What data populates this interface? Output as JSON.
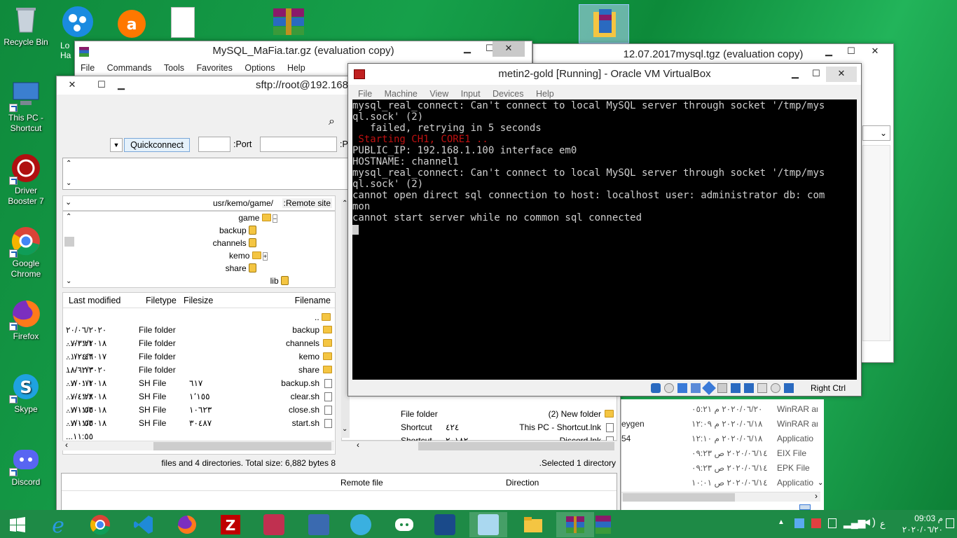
{
  "desktop_icons": [
    {
      "label": "Recycle Bin",
      "color": "#9aa6b2"
    },
    {
      "label": "This PC - Shortcut",
      "color": "#3b7fd0"
    },
    {
      "label": "Driver Booster 7",
      "color": "#d01818"
    },
    {
      "label": "Google Chrome",
      "color": "#e0a020"
    },
    {
      "label": "Firefox",
      "color": "#ff7a1a"
    },
    {
      "label": "Skype",
      "color": "#1fa2e0"
    },
    {
      "label": "Discord",
      "color": "#5865f2"
    }
  ],
  "top_icons_label": "Lo\nHa",
  "rar1": {
    "title": "MySQL_MaFia.tar.gz (evaluation copy)",
    "menu": [
      "File",
      "Commands",
      "Tools",
      "Favorites",
      "Options",
      "Help"
    ]
  },
  "rar2": {
    "title": "12.07.2017mysql.tgz (evaluation copy)"
  },
  "filezilla": {
    "title": "sftp://root@192.168",
    "quickconnect": "Quickconnect",
    "port_label": ":Port",
    "remote_label": ":Remote site",
    "remote_path": "usr/kemo/game/",
    "tree": [
      "game",
      "backup",
      "channels",
      "kemo",
      "share",
      "lib"
    ],
    "headers": [
      "Last modified",
      "Filetype",
      "Filesize",
      "Filename"
    ],
    "parent": "..",
    "rows": [
      {
        "name": "backup",
        "type": "File folder",
        "size": "",
        "date": "٢٠/٠٦/٢٠٢٠ ٠٣:٢١...",
        "kind": "folder"
      },
      {
        "name": "channels",
        "type": "File folder",
        "size": "",
        "date": "٠٧/٠١/٢٠١٨ ١٢:٤٦...",
        "kind": "folder"
      },
      {
        "name": "kemo",
        "type": "File folder",
        "size": "",
        "date": "٠١/٠٤/٢٠١٧ ٠٦:١٣...",
        "kind": "folder"
      },
      {
        "name": "share",
        "type": "File folder",
        "size": "",
        "date": "١٨/٠٢/٢٠٢٠ ١٠:١١...",
        "kind": "folder"
      },
      {
        "name": "backup.sh",
        "type": "SH File",
        "size": "٦١٧",
        "date": "٠٧/٠١/٢٠١٨ ٠٤:٢٨...",
        "kind": "file"
      },
      {
        "name": "clear.sh",
        "type": "SH File",
        "size": "١٬١٥٥",
        "date": "٠٧/٠١/٢٠١٨ ١١:٥٥...",
        "kind": "file"
      },
      {
        "name": "close.sh",
        "type": "SH File",
        "size": "١٠٦٢٣",
        "date": "٠٧/٠١/٢٠١٨ ١١:٥٥...",
        "kind": "file"
      },
      {
        "name": "start.sh",
        "type": "SH File",
        "size": "٣٠٤٨٧",
        "date": "٠٧/٠١/٢٠١٨ ١١:٥٥...",
        "kind": "file"
      }
    ],
    "status_left": "files and 4 directories. Total size: 6,882 bytes 8",
    "status_right": ".Selected 1 directory",
    "local_rows": [
      {
        "name": "(2) New folder",
        "type": "File folder",
        "size": ""
      },
      {
        "name": "This PC - Shortcut.lnk",
        "type": "Shortcut",
        "size": "٤٢٤"
      },
      {
        "name": "Discord.lnk",
        "type": "Shortcut",
        "size": "٢٠١٨٢"
      }
    ],
    "queue_headers": [
      "Remote file",
      "Direction"
    ]
  },
  "vbox": {
    "title": "metin2-gold [Running] - Oracle VM VirtualBox",
    "menu": [
      "File",
      "Machine",
      "View",
      "Input",
      "Devices",
      "Help"
    ],
    "terminal": [
      {
        "text": "mysql_real_connect: Can't connect to local MySQL server through socket '/tmp/mys",
        "red": false
      },
      {
        "text": "ql.sock' (2)",
        "red": false
      },
      {
        "text": "   failed, retrying in 5 seconds",
        "red": false
      },
      {
        "text": " Starting CH1, CORE1 ..",
        "red": true
      },
      {
        "text": "PUBLIC_IP: 192.168.1.100 interface em0",
        "red": false
      },
      {
        "text": "HOSTNAME: channel1",
        "red": false
      },
      {
        "text": "mysql_real_connect: Can't connect to local MySQL server through socket '/tmp/mys",
        "red": false
      },
      {
        "text": "ql.sock' (2)",
        "red": false
      },
      {
        "text": "cannot open direct sql connection to host: localhost user: administrator db: com",
        "red": false
      },
      {
        "text": "mon",
        "red": false
      },
      {
        "text": "cannot start server while no common sql connected",
        "red": false
      }
    ],
    "host_key": "Right Ctrl"
  },
  "explorer_rows": [
    {
      "name": "",
      "date": "٢٠٢٠/٠٦/٢٠ م ٠٥:٢١",
      "type": "WinRAR ar"
    },
    {
      "name": "eygen",
      "date": "٢٠٢٠/٠٦/١٨ م ١٢:٠٩",
      "type": "WinRAR ar"
    },
    {
      "name": "54",
      "date": "٢٠٢٠/٠٦/١٨ م ١٢:١٠",
      "type": "Applicatio"
    },
    {
      "name": "",
      "date": "٢٠٢٠/٠٦/١٤ ص ٠٩:٢٣",
      "type": "EIX File"
    },
    {
      "name": "",
      "date": "٢٠٢٠/٠٦/١٤ ص ٠٩:٢٣",
      "type": "EPK File"
    },
    {
      "name": "",
      "date": "٢٠٢٠/٠٦/١٤ ص ١٠:٠١",
      "type": "Applicatio"
    }
  ],
  "taskbar": {
    "time": "09:03 م",
    "date": "٢٠٢٠/٠٦/٢٠",
    "lang": "ع",
    "apps": [
      "ie",
      "chrome",
      "vscode",
      "firefox",
      "filezilla",
      "game",
      "network",
      "bluestacks",
      "discord",
      "virtualbox",
      "notepad",
      "explorer",
      "winrar"
    ]
  }
}
